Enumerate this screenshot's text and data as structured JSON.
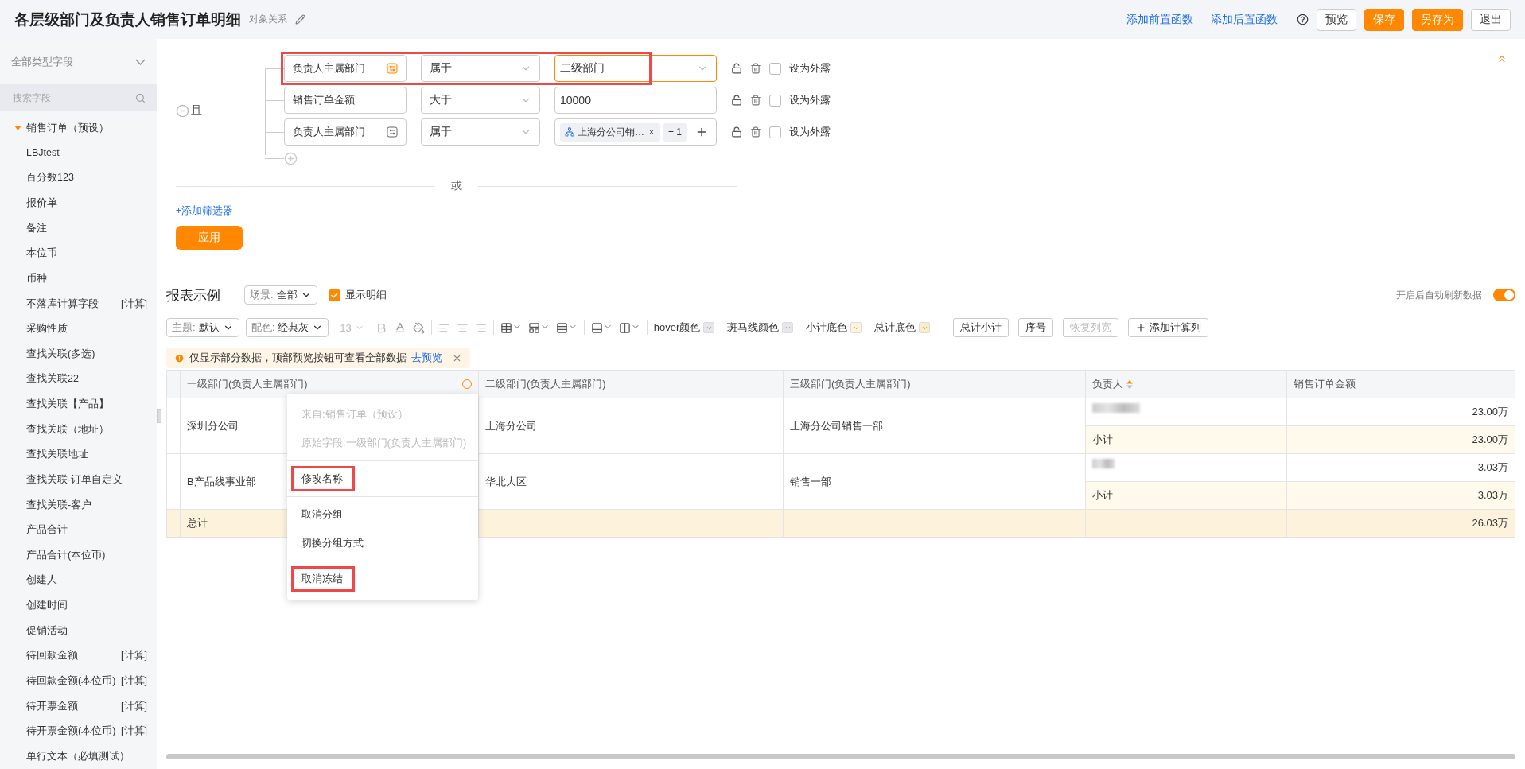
{
  "header": {
    "title": "各层级部门及负责人销售订单明细",
    "subtitle": "对象关系",
    "links": [
      "添加前置函数",
      "添加后置函数"
    ],
    "buttons": [
      {
        "label": "预览",
        "kind": "default"
      },
      {
        "label": "保存",
        "kind": "primary"
      },
      {
        "label": "另存为",
        "kind": "primary"
      },
      {
        "label": "退出",
        "kind": "default"
      }
    ]
  },
  "sidebar": {
    "type_select": "全部类型字段",
    "search": {
      "placeholder": "搜索字段"
    },
    "tree": [
      {
        "label": "销售订单（预设）",
        "expanded": true,
        "children": [
          {
            "label": "LBJtest"
          },
          {
            "label": "百分数123"
          },
          {
            "label": "报价单"
          },
          {
            "label": "备注"
          },
          {
            "label": "本位币"
          },
          {
            "label": "币种"
          },
          {
            "label": "不落库计算字段",
            "tag": "[计算]"
          },
          {
            "label": "采购性质"
          },
          {
            "label": "查找关联(多选)"
          },
          {
            "label": "查找关联22"
          },
          {
            "label": "查找关联【产品】"
          },
          {
            "label": "查找关联（地址）"
          },
          {
            "label": "查找关联地址"
          },
          {
            "label": "查找关联-订单自定义"
          },
          {
            "label": "查找关联-客户"
          },
          {
            "label": "产品合计"
          },
          {
            "label": "产品合计(本位币)"
          },
          {
            "label": "创建人"
          },
          {
            "label": "创建时间"
          },
          {
            "label": "促销活动"
          },
          {
            "label": "待回款金额",
            "tag": "[计算]"
          },
          {
            "label": "待回款金额(本位币)",
            "tag": "[计算]"
          },
          {
            "label": "待开票金额",
            "tag": "[计算]"
          },
          {
            "label": "待开票金额(本位币)",
            "tag": "[计算]"
          },
          {
            "label": "单行文本（必填测试）"
          }
        ]
      }
    ]
  },
  "filter": {
    "logic": "且",
    "rows": [
      {
        "field": "负责人主属部门",
        "has_picker": true,
        "picker_active": true,
        "highlighted": true,
        "operator": "属于",
        "value": {
          "kind": "select",
          "text": "二级部门",
          "focused": true
        },
        "expose": {
          "label": "设为外露",
          "checked": false
        }
      },
      {
        "field": "销售订单金额",
        "highlighted": false,
        "operator": "大于",
        "value": {
          "kind": "text",
          "text": "10000",
          "focused": false
        },
        "expose": {
          "label": "设为外露",
          "checked": false
        }
      },
      {
        "field": "负责人主属部门",
        "has_picker": true,
        "picker_active": false,
        "highlighted": false,
        "operator": "属于",
        "value": {
          "kind": "tags",
          "tags": [
            "上海分公司销…"
          ],
          "more": "+ 1",
          "focused": false
        },
        "expose": {
          "label": "设为外露",
          "checked": false
        }
      }
    ],
    "or_label": "或",
    "add_filter": "+添加筛选器",
    "apply": "应用"
  },
  "report": {
    "title": "报表示例",
    "scene": {
      "label": "场景:",
      "value": "全部"
    },
    "show_detail": {
      "label": "显示明细",
      "checked": true
    },
    "auto_refresh": {
      "label": "开启后自动刷新数据",
      "on": true
    },
    "toolbar": {
      "theme": {
        "label": "主题:",
        "value": "默认"
      },
      "palette": {
        "label": "配色:",
        "value": "经典灰"
      },
      "font_size": "13",
      "colors": [
        {
          "label": "hover颜色",
          "color": "#e6e7ea"
        },
        {
          "label": "斑马线颜色",
          "color": "#e6e7ea"
        },
        {
          "label": "小计底色",
          "color": "#fdf3d9"
        },
        {
          "label": "总计底色",
          "color": "#fdecc4"
        }
      ],
      "buttons": [
        {
          "label": "总计小计",
          "kind": "plain",
          "disabled": false
        },
        {
          "label": "序号",
          "kind": "plain",
          "disabled": false
        },
        {
          "label": "恢复列宽",
          "kind": "plain",
          "disabled": true
        },
        {
          "label": "添加计算列",
          "kind": "add",
          "disabled": false
        }
      ]
    },
    "notice": {
      "text": "仅显示部分数据，顶部预览按钮可查看全部数据",
      "link": "去预览"
    },
    "table": {
      "columns": [
        {
          "label": "一级部门(负责人主属部门)",
          "menu": true
        },
        {
          "label": "二级部门(负责人主属部门)"
        },
        {
          "label": "三级部门(负责人主属部门)"
        },
        {
          "label": "负责人",
          "sorted_ascending": true
        },
        {
          "label": "销售订单金额"
        }
      ],
      "groups": [
        {
          "level1": "深圳分公司",
          "level2": "上海分公司",
          "level3": "上海分公司销售一部",
          "rows": [
            {
              "kind": "detail",
              "amount": "23.00万"
            },
            {
              "kind": "subtotal",
              "label": "小计",
              "amount": "23.00万"
            }
          ]
        },
        {
          "level1": "B产品线事业部",
          "level2": "华北大区",
          "level3": "销售一部",
          "rows": [
            {
              "kind": "detail",
              "amount": "3.03万"
            },
            {
              "kind": "subtotal",
              "label": "小计",
              "amount": "3.03万"
            }
          ]
        }
      ],
      "total": {
        "label": "总计",
        "amount": "26.03万"
      }
    },
    "context_menu": {
      "sections": [
        [
          {
            "label": "来自:销售订单（预设）",
            "disabled": true,
            "highlighted": false
          },
          {
            "label": "原始字段:一级部门(负责人主属部门)",
            "disabled": true,
            "highlighted": false
          }
        ],
        [
          {
            "label": "修改名称",
            "disabled": false,
            "highlighted": true
          }
        ],
        [
          {
            "label": "取消分组",
            "disabled": false,
            "highlighted": false
          },
          {
            "label": "切换分组方式",
            "disabled": false,
            "highlighted": false
          }
        ],
        [
          {
            "label": "取消冻结",
            "disabled": false,
            "highlighted": true
          }
        ]
      ]
    }
  }
}
